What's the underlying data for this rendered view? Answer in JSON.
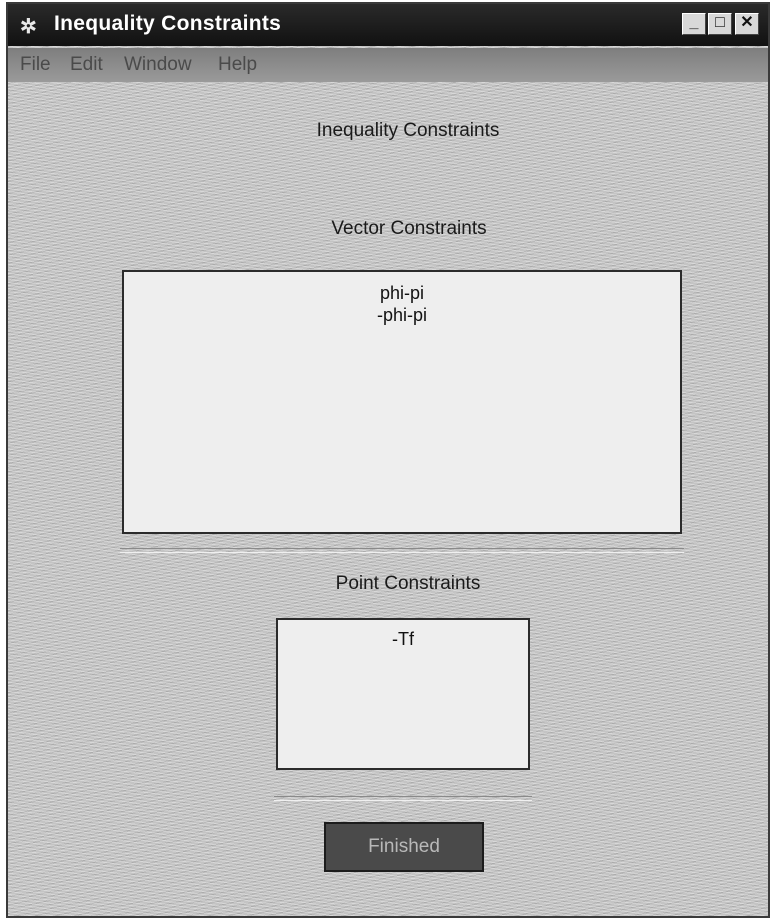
{
  "window": {
    "title": "Inequality Constraints",
    "app_icon": "✲",
    "controls": {
      "minimize_glyph": "_",
      "maximize_glyph": "□",
      "close_glyph": "✕"
    }
  },
  "menu": {
    "items": [
      "File",
      "Edit",
      "Window",
      "Help"
    ]
  },
  "main": {
    "heading": "Inequality Constraints",
    "vector_label": "Vector Constraints",
    "vector_items": [
      "phi-pi",
      "-phi-pi"
    ],
    "point_label": "Point Constraints",
    "point_items": [
      "-Tf"
    ],
    "finished_label": "Finished"
  },
  "icons": {
    "app": "matlab-figure-icon",
    "minimize": "minimize-icon",
    "maximize": "maximize-icon",
    "close": "close-icon"
  },
  "colors": {
    "titlebar": "#1a1a1a",
    "window_bg": "#c4c4c4",
    "listbox_bg": "#eeeeee",
    "button_bg": "#4a4a4a"
  }
}
